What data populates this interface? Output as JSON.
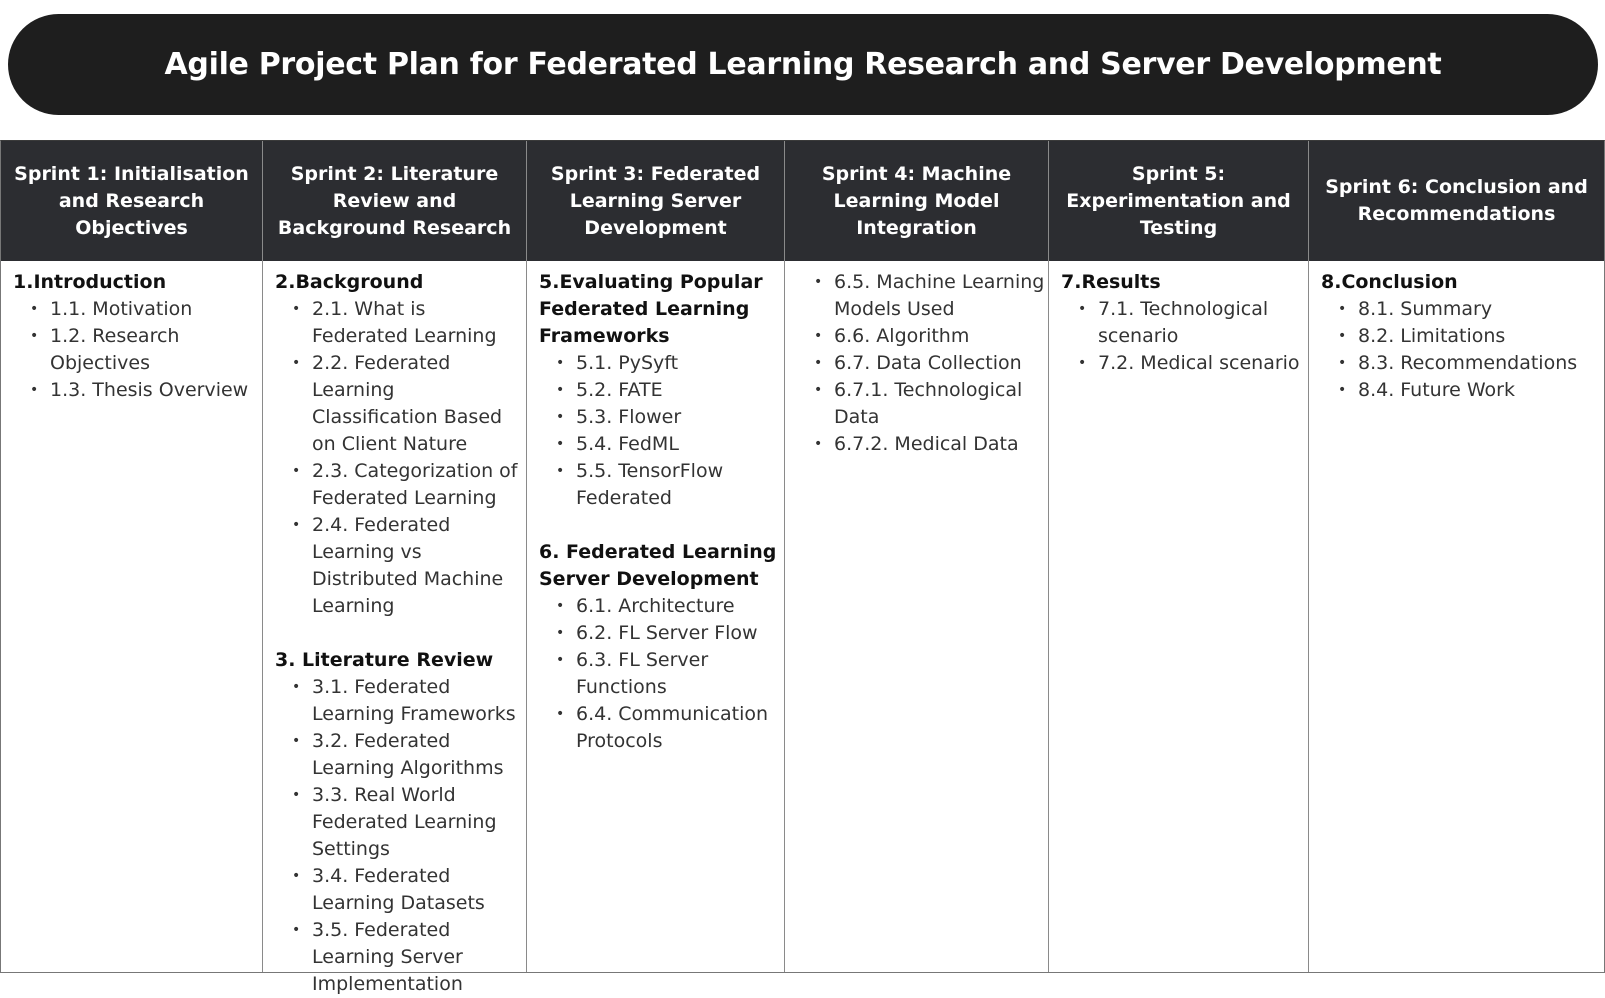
{
  "title": "Agile Project Plan for Federated Learning Research and Server Development",
  "colors": {
    "banner": "#1e1e1e",
    "header": "#2c2d31",
    "header_text": "#ffffff",
    "body_text": "#333333"
  },
  "sprints": [
    {
      "header": "Sprint 1: Initialisation and Research Objectives",
      "sections": [
        {
          "title": "1.Introduction",
          "items": [
            "1.1. Motivation",
            "1.2. Research Objectives",
            "1.3. Thesis Overview"
          ]
        }
      ]
    },
    {
      "header": "Sprint 2: Literature Review and Background Research",
      "sections": [
        {
          "title": "2.Background",
          "items": [
            "2.1. What is Federated Learning",
            "2.2. Federated Learning Classification Based on Client Nature",
            "2.3. Categorization of Federated Learning",
            "2.4. Federated Learning vs Distributed Machine Learning"
          ]
        },
        {
          "title": "3. Literature Review",
          "items": [
            "3.1. Federated Learning Frameworks",
            "3.2. Federated Learning Algorithms",
            "3.3. Real World Federated Learning Settings",
            "3.4. Federated Learning Datasets",
            "3.5. Federated Learning Server Implementation"
          ]
        }
      ]
    },
    {
      "header": "Sprint 3: Federated Learning Server Development",
      "sections": [
        {
          "title": "5.Evaluating Popular Federated Learning Frameworks",
          "items": [
            "5.1. PySyft",
            "5.2. FATE",
            "5.3. Flower",
            "5.4. FedML",
            "5.5. TensorFlow Federated"
          ]
        },
        {
          "title": "6. Federated Learning Server Development",
          "items": [
            "6.1. Architecture",
            "6.2. FL Server Flow",
            "6.3. FL Server Functions",
            "6.4. Communication Protocols"
          ]
        }
      ]
    },
    {
      "header": "Sprint 4: Machine Learning Model Integration",
      "sections": [
        {
          "title": "",
          "items": [
            "6.5. Machine Learning Models Used",
            "6.6. Algorithm",
            "6.7. Data Collection",
            "6.7.1. Technological Data",
            "6.7.2. Medical Data"
          ]
        }
      ]
    },
    {
      "header": "Sprint 5: Experimentation and Testing",
      "sections": [
        {
          "title": "7.Results",
          "items": [
            "7.1. Technological scenario",
            "7.2. Medical scenario"
          ]
        }
      ]
    },
    {
      "header": "Sprint 6: Conclusion and Recommendations",
      "sections": [
        {
          "title": "8.Conclusion",
          "items": [
            "8.1. Summary",
            "8.2. Limitations",
            "8.3. Recommendations",
            "8.4. Future Work"
          ]
        }
      ]
    }
  ]
}
